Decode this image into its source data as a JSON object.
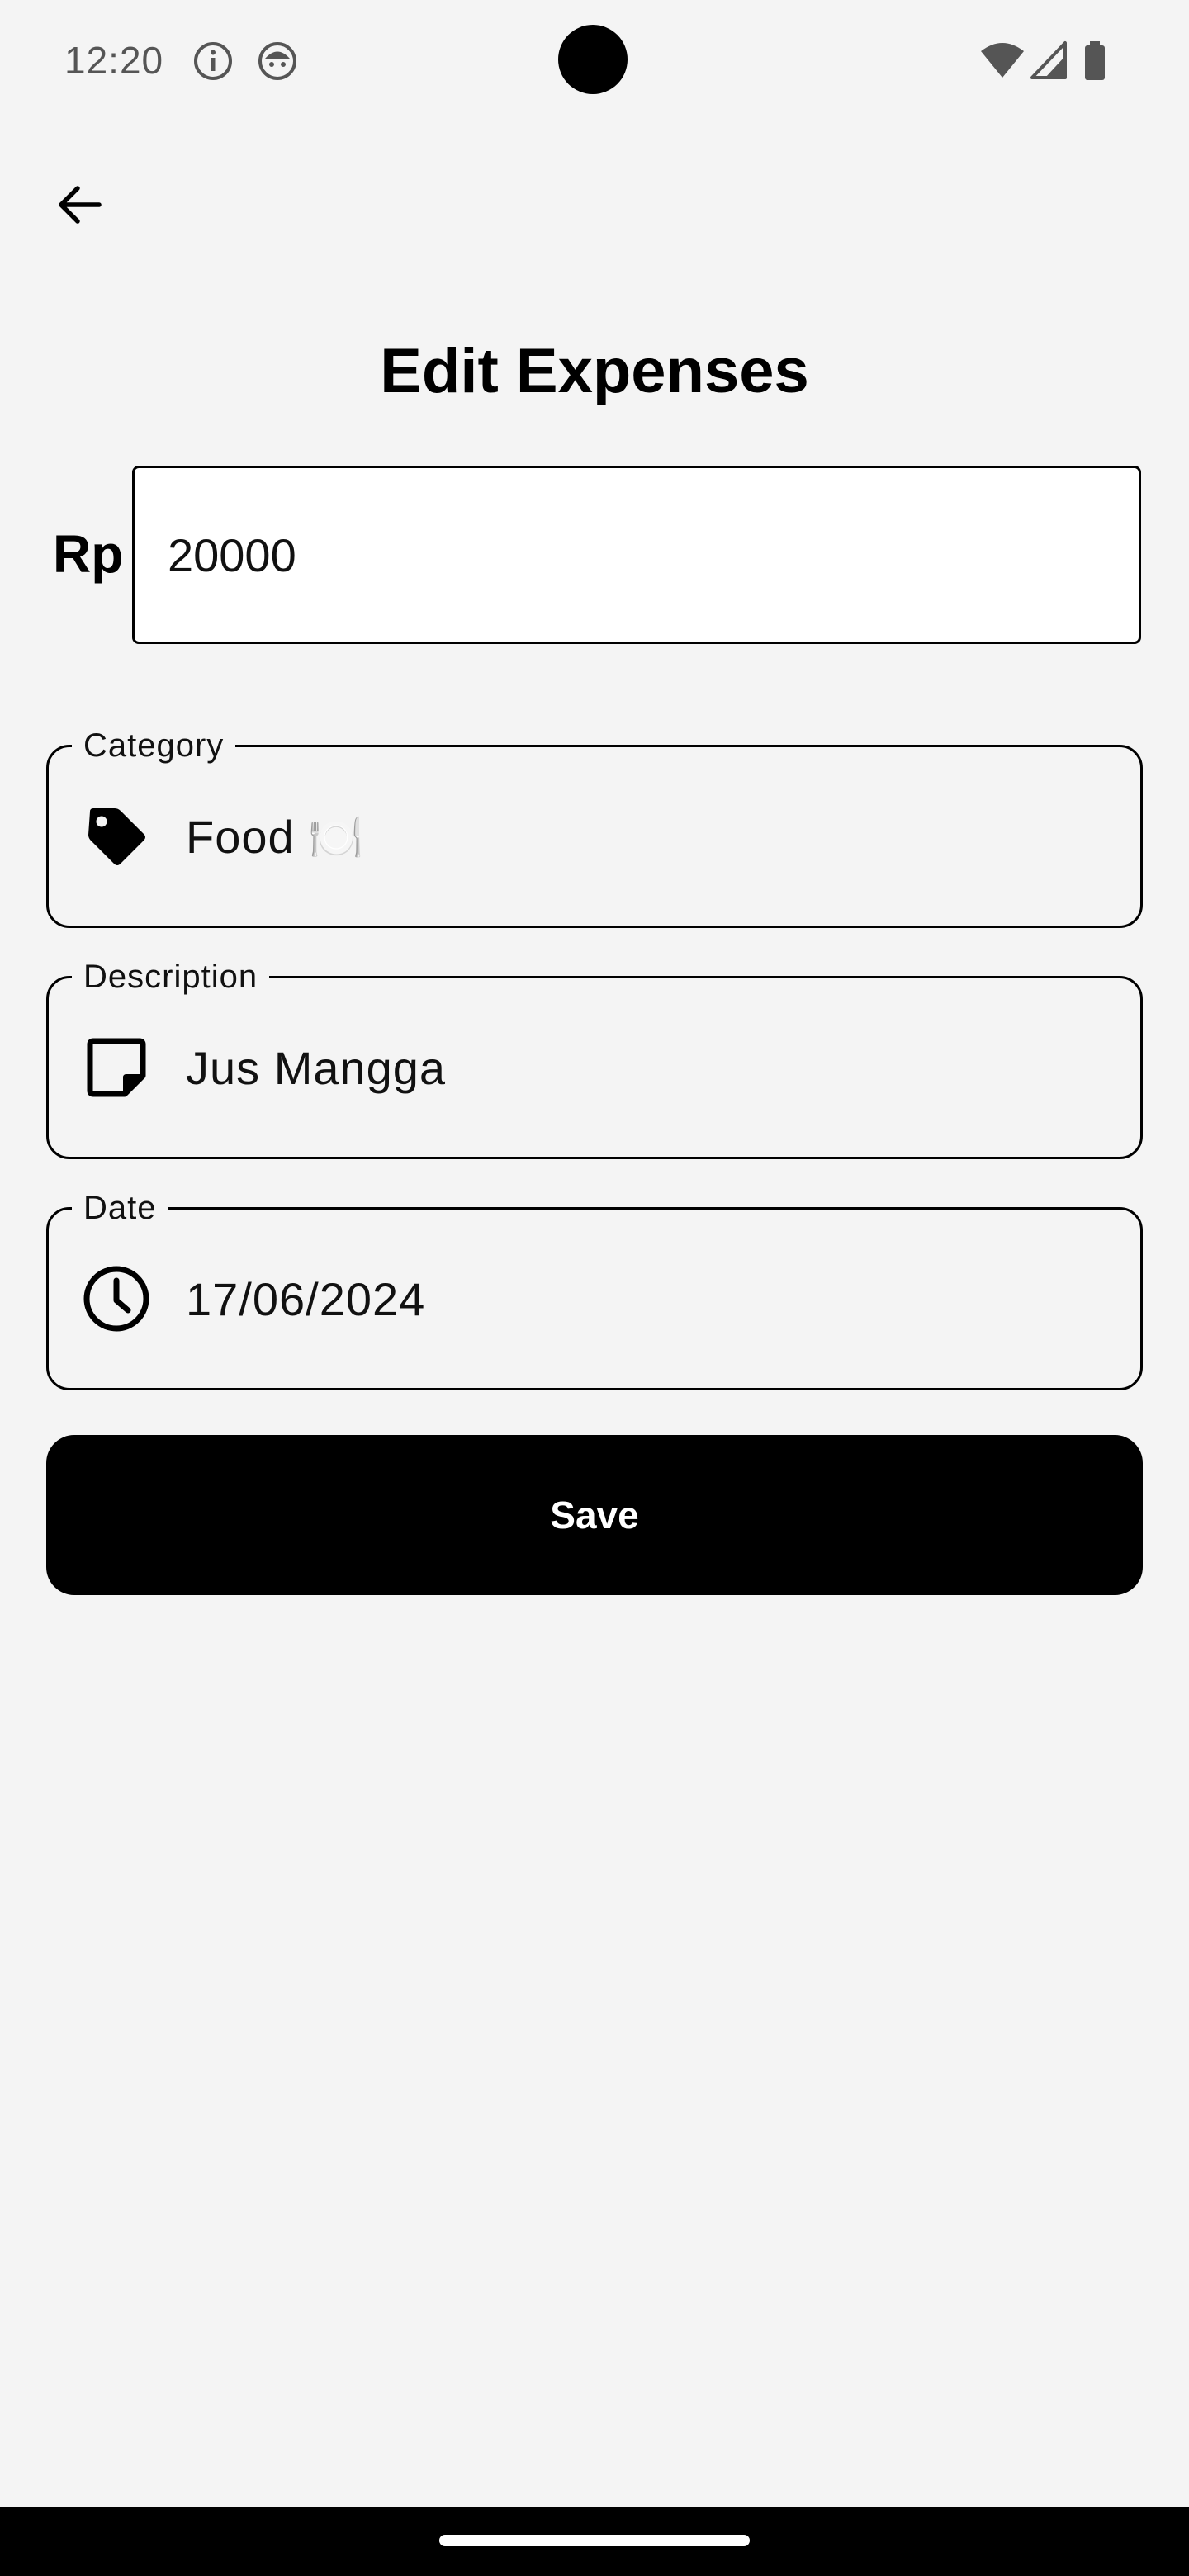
{
  "status_bar": {
    "time": "12:20",
    "left_icons": [
      "info-icon",
      "android-face-icon"
    ],
    "right_icons": [
      "wifi-icon",
      "cell-signal-icon",
      "battery-icon"
    ]
  },
  "header": {
    "back_icon": "arrow-left-icon",
    "title": "Edit Expenses"
  },
  "amount": {
    "currency": "Rp",
    "value": "20000"
  },
  "fields": {
    "category": {
      "label": "Category",
      "icon": "tag-icon",
      "value": "Food",
      "emoji": "🍽️"
    },
    "description": {
      "label": "Description",
      "icon": "sticky-note-icon",
      "value": "Jus Mangga"
    },
    "date": {
      "label": "Date",
      "icon": "clock-icon",
      "value": "17/06/2024"
    }
  },
  "actions": {
    "save_label": "Save"
  },
  "colors": {
    "background": "#f4f4f4",
    "primary": "#000000",
    "on_primary": "#ffffff"
  }
}
